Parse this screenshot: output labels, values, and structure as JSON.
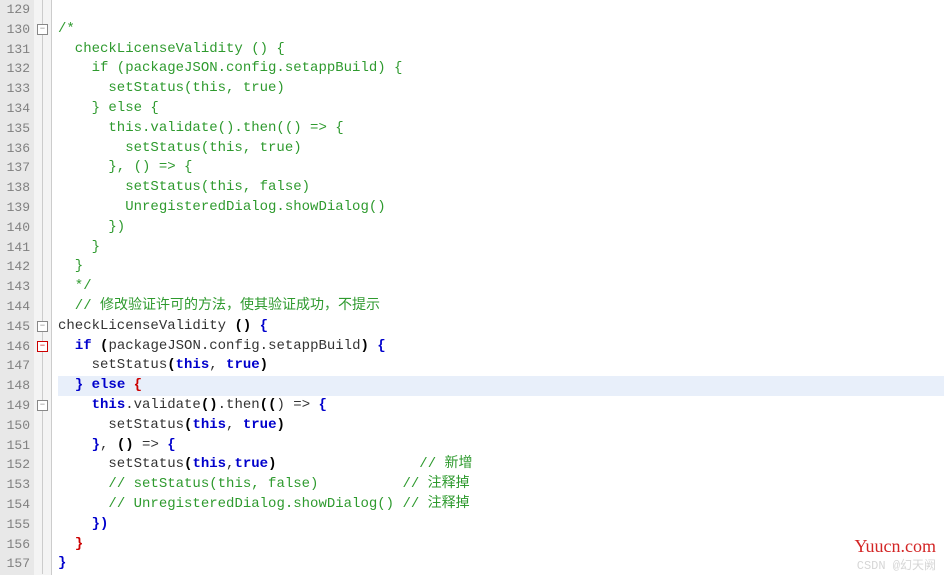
{
  "line_start": 129,
  "line_end": 157,
  "highlighted_line": 148,
  "fold_markers": [
    {
      "line": 130,
      "color": "gray"
    },
    {
      "line": 145,
      "color": "gray"
    },
    {
      "line": 146,
      "color": "red"
    },
    {
      "line": 149,
      "color": "gray"
    }
  ],
  "lines": [
    {
      "n": 129,
      "segs": []
    },
    {
      "n": 130,
      "segs": [
        {
          "t": "/*",
          "c": "c-comment"
        }
      ]
    },
    {
      "n": 131,
      "segs": [
        {
          "t": "  checkLicenseValidity () {",
          "c": "c-comment"
        }
      ]
    },
    {
      "n": 132,
      "segs": [
        {
          "t": "    if (packageJSON.config.setappBuild) {",
          "c": "c-comment"
        }
      ]
    },
    {
      "n": 133,
      "segs": [
        {
          "t": "      setStatus(this, true)",
          "c": "c-comment"
        }
      ]
    },
    {
      "n": 134,
      "segs": [
        {
          "t": "    } else {",
          "c": "c-comment"
        }
      ]
    },
    {
      "n": 135,
      "segs": [
        {
          "t": "      this.validate().then(() => {",
          "c": "c-comment"
        }
      ]
    },
    {
      "n": 136,
      "segs": [
        {
          "t": "        setStatus(this, true)",
          "c": "c-comment"
        }
      ]
    },
    {
      "n": 137,
      "segs": [
        {
          "t": "      }, () => {",
          "c": "c-comment"
        }
      ]
    },
    {
      "n": 138,
      "segs": [
        {
          "t": "        setStatus(this, false)",
          "c": "c-comment"
        }
      ]
    },
    {
      "n": 139,
      "segs": [
        {
          "t": "        UnregisteredDialog.showDialog()",
          "c": "c-comment"
        }
      ]
    },
    {
      "n": 140,
      "segs": [
        {
          "t": "      })",
          "c": "c-comment"
        }
      ]
    },
    {
      "n": 141,
      "segs": [
        {
          "t": "    }",
          "c": "c-comment"
        }
      ]
    },
    {
      "n": 142,
      "segs": [
        {
          "t": "  }",
          "c": "c-comment"
        }
      ]
    },
    {
      "n": 143,
      "segs": [
        {
          "t": "  */",
          "c": "c-comment"
        }
      ]
    },
    {
      "n": 144,
      "segs": [
        {
          "t": "  // 修改验证许可的方法，使其验证成功，不提示",
          "c": "c-comment"
        }
      ]
    },
    {
      "n": 145,
      "segs": [
        {
          "t": "checkLicenseValidity ",
          "c": "c-punct"
        },
        {
          "t": "()",
          "c": "c-bold"
        },
        {
          "t": " ",
          "c": ""
        },
        {
          "t": "{",
          "c": "c-brace-b"
        }
      ]
    },
    {
      "n": 146,
      "segs": [
        {
          "t": "  ",
          "c": ""
        },
        {
          "t": "if",
          "c": "c-kw"
        },
        {
          "t": " ",
          "c": ""
        },
        {
          "t": "(",
          "c": "c-bold"
        },
        {
          "t": "packageJSON.config.setappBuild",
          "c": "c-punct"
        },
        {
          "t": ")",
          "c": "c-bold"
        },
        {
          "t": " ",
          "c": ""
        },
        {
          "t": "{",
          "c": "c-brace-b"
        }
      ]
    },
    {
      "n": 147,
      "segs": [
        {
          "t": "    setStatus",
          "c": "c-punct"
        },
        {
          "t": "(",
          "c": "c-bold"
        },
        {
          "t": "this",
          "c": "c-kw"
        },
        {
          "t": ", ",
          "c": "c-punct"
        },
        {
          "t": "true",
          "c": "c-kw"
        },
        {
          "t": ")",
          "c": "c-bold"
        }
      ]
    },
    {
      "n": 148,
      "hl": true,
      "segs": [
        {
          "t": "  ",
          "c": ""
        },
        {
          "t": "}",
          "c": "c-brace-b"
        },
        {
          "t": " ",
          "c": ""
        },
        {
          "t": "else",
          "c": "c-kw"
        },
        {
          "t": " ",
          "c": ""
        },
        {
          "t": "{",
          "c": "c-brace-r"
        }
      ]
    },
    {
      "n": 149,
      "segs": [
        {
          "t": "    ",
          "c": ""
        },
        {
          "t": "this",
          "c": "c-kw"
        },
        {
          "t": ".validate",
          "c": "c-punct"
        },
        {
          "t": "()",
          "c": "c-bold"
        },
        {
          "t": ".then",
          "c": "c-punct"
        },
        {
          "t": "((",
          "c": "c-bold"
        },
        {
          "t": ") => ",
          "c": "c-punct"
        },
        {
          "t": "{",
          "c": "c-brace-b"
        }
      ]
    },
    {
      "n": 150,
      "segs": [
        {
          "t": "      setStatus",
          "c": "c-punct"
        },
        {
          "t": "(",
          "c": "c-bold"
        },
        {
          "t": "this",
          "c": "c-kw"
        },
        {
          "t": ", ",
          "c": "c-punct"
        },
        {
          "t": "true",
          "c": "c-kw"
        },
        {
          "t": ")",
          "c": "c-bold"
        }
      ]
    },
    {
      "n": 151,
      "segs": [
        {
          "t": "    ",
          "c": ""
        },
        {
          "t": "}",
          "c": "c-brace-b"
        },
        {
          "t": ", ",
          "c": "c-punct"
        },
        {
          "t": "()",
          "c": "c-bold"
        },
        {
          "t": " => ",
          "c": "c-punct"
        },
        {
          "t": "{",
          "c": "c-brace-b"
        }
      ]
    },
    {
      "n": 152,
      "segs": [
        {
          "t": "      setStatus",
          "c": "c-punct"
        },
        {
          "t": "(",
          "c": "c-bold"
        },
        {
          "t": "this",
          "c": "c-kw"
        },
        {
          "t": ",",
          "c": "c-punct"
        },
        {
          "t": "true",
          "c": "c-kw"
        },
        {
          "t": ")",
          "c": "c-bold"
        },
        {
          "t": "                 ",
          "c": ""
        },
        {
          "t": "// 新增",
          "c": "c-comment"
        }
      ]
    },
    {
      "n": 153,
      "segs": [
        {
          "t": "      ",
          "c": ""
        },
        {
          "t": "// setStatus(this, false)          // 注释掉",
          "c": "c-comment"
        }
      ]
    },
    {
      "n": 154,
      "segs": [
        {
          "t": "      ",
          "c": ""
        },
        {
          "t": "// UnregisteredDialog.showDialog() // 注释掉",
          "c": "c-comment"
        }
      ]
    },
    {
      "n": 155,
      "segs": [
        {
          "t": "    ",
          "c": ""
        },
        {
          "t": "})",
          "c": "c-brace-b"
        }
      ]
    },
    {
      "n": 156,
      "segs": [
        {
          "t": "  ",
          "c": ""
        },
        {
          "t": "}",
          "c": "c-brace-r"
        }
      ]
    },
    {
      "n": 157,
      "segs": [
        {
          "t": "}",
          "c": "c-brace-b"
        }
      ]
    }
  ],
  "watermark_main": "Yuucn.com",
  "watermark_sub": "CSDN @幻天阙"
}
